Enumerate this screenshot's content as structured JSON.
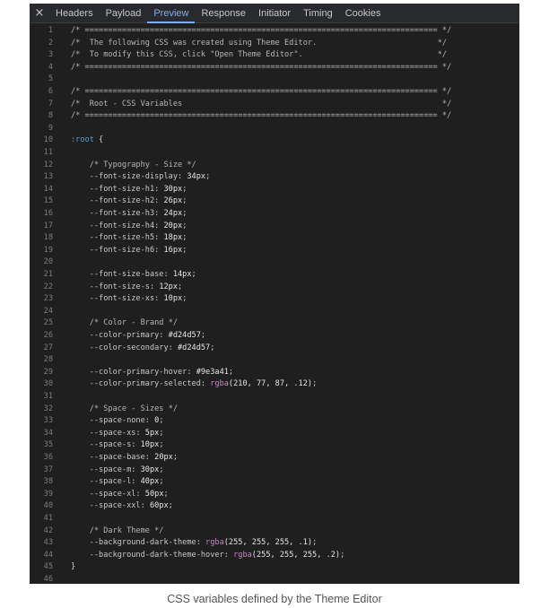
{
  "tabs": [
    {
      "label": "Headers",
      "active": false
    },
    {
      "label": "Payload",
      "active": false
    },
    {
      "label": "Preview",
      "active": true
    },
    {
      "label": "Response",
      "active": false
    },
    {
      "label": "Initiator",
      "active": false
    },
    {
      "label": "Timing",
      "active": false
    },
    {
      "label": "Cookies",
      "active": false
    }
  ],
  "close_icon": "×",
  "lines": [
    {
      "n": "1",
      "parts": [
        [
          "comment",
          "/* ============================================================================ */"
        ]
      ]
    },
    {
      "n": "2",
      "parts": [
        [
          "comment",
          "/*  The following CSS was created using Theme Editor.                          */"
        ]
      ]
    },
    {
      "n": "3",
      "parts": [
        [
          "comment",
          "/*  To modify this CSS, click \"Open Theme Editor\".                             */"
        ]
      ]
    },
    {
      "n": "4",
      "parts": [
        [
          "comment",
          "/* ============================================================================ */"
        ]
      ]
    },
    {
      "n": "5",
      "parts": []
    },
    {
      "n": "6",
      "parts": [
        [
          "comment",
          "/* ============================================================================ */"
        ]
      ]
    },
    {
      "n": "7",
      "parts": [
        [
          "comment",
          "/*  Root - CSS Variables                                                        */"
        ]
      ]
    },
    {
      "n": "8",
      "parts": [
        [
          "comment",
          "/* ============================================================================ */"
        ]
      ]
    },
    {
      "n": "9",
      "parts": []
    },
    {
      "n": "10",
      "parts": [
        [
          "selector",
          ":root"
        ],
        [
          "brace",
          " {"
        ]
      ]
    },
    {
      "n": "11",
      "parts": []
    },
    {
      "n": "12",
      "parts": [
        [
          "comment",
          "    /* Typography - Size */"
        ]
      ]
    },
    {
      "n": "13",
      "parts": [
        [
          "prop",
          "    --font-size-display: "
        ],
        [
          "num",
          "34px"
        ],
        [
          "prop",
          ";"
        ]
      ]
    },
    {
      "n": "14",
      "parts": [
        [
          "prop",
          "    --font-size-h1: "
        ],
        [
          "num",
          "30px"
        ],
        [
          "prop",
          ";"
        ]
      ]
    },
    {
      "n": "15",
      "parts": [
        [
          "prop",
          "    --font-size-h2: "
        ],
        [
          "num",
          "26px"
        ],
        [
          "prop",
          ";"
        ]
      ]
    },
    {
      "n": "16",
      "parts": [
        [
          "prop",
          "    --font-size-h3: "
        ],
        [
          "num",
          "24px"
        ],
        [
          "prop",
          ";"
        ]
      ]
    },
    {
      "n": "17",
      "parts": [
        [
          "prop",
          "    --font-size-h4: "
        ],
        [
          "num",
          "20px"
        ],
        [
          "prop",
          ";"
        ]
      ]
    },
    {
      "n": "18",
      "parts": [
        [
          "prop",
          "    --font-size-h5: "
        ],
        [
          "num",
          "18px"
        ],
        [
          "prop",
          ";"
        ]
      ]
    },
    {
      "n": "19",
      "parts": [
        [
          "prop",
          "    --font-size-h6: "
        ],
        [
          "num",
          "16px"
        ],
        [
          "prop",
          ";"
        ]
      ]
    },
    {
      "n": "20",
      "parts": []
    },
    {
      "n": "21",
      "parts": [
        [
          "prop",
          "    --font-size-base: "
        ],
        [
          "num",
          "14px"
        ],
        [
          "prop",
          ";"
        ]
      ]
    },
    {
      "n": "22",
      "parts": [
        [
          "prop",
          "    --font-size-s: "
        ],
        [
          "num",
          "12px"
        ],
        [
          "prop",
          ";"
        ]
      ]
    },
    {
      "n": "23",
      "parts": [
        [
          "prop",
          "    --font-size-xs: "
        ],
        [
          "num",
          "10px"
        ],
        [
          "prop",
          ";"
        ]
      ]
    },
    {
      "n": "24",
      "parts": []
    },
    {
      "n": "25",
      "parts": [
        [
          "comment",
          "    /* Color - Brand */"
        ]
      ]
    },
    {
      "n": "26",
      "parts": [
        [
          "prop",
          "    --color-primary: "
        ],
        [
          "num",
          "#d24d57"
        ],
        [
          "prop",
          ";"
        ]
      ]
    },
    {
      "n": "27",
      "parts": [
        [
          "prop",
          "    --color-secondary: "
        ],
        [
          "num",
          "#d24d57"
        ],
        [
          "prop",
          ";"
        ]
      ]
    },
    {
      "n": "28",
      "parts": []
    },
    {
      "n": "29",
      "parts": [
        [
          "prop",
          "    --color-primary-hover: "
        ],
        [
          "num",
          "#9e3a41"
        ],
        [
          "prop",
          ";"
        ]
      ]
    },
    {
      "n": "30",
      "parts": [
        [
          "prop",
          "    --color-primary-selected: "
        ],
        [
          "fn",
          "rgba"
        ],
        [
          "num",
          "(210, 77, 87, .12)"
        ],
        [
          "prop",
          ";"
        ]
      ]
    },
    {
      "n": "31",
      "parts": []
    },
    {
      "n": "32",
      "parts": [
        [
          "comment",
          "    /* Space - Sizes */"
        ]
      ]
    },
    {
      "n": "33",
      "parts": [
        [
          "prop",
          "    --space-none: "
        ],
        [
          "num",
          "0"
        ],
        [
          "prop",
          ";"
        ]
      ]
    },
    {
      "n": "34",
      "parts": [
        [
          "prop",
          "    --space-xs: "
        ],
        [
          "num",
          "5px"
        ],
        [
          "prop",
          ";"
        ]
      ]
    },
    {
      "n": "35",
      "parts": [
        [
          "prop",
          "    --space-s: "
        ],
        [
          "num",
          "10px"
        ],
        [
          "prop",
          ";"
        ]
      ]
    },
    {
      "n": "36",
      "parts": [
        [
          "prop",
          "    --space-base: "
        ],
        [
          "num",
          "20px"
        ],
        [
          "prop",
          ";"
        ]
      ]
    },
    {
      "n": "37",
      "parts": [
        [
          "prop",
          "    --space-m: "
        ],
        [
          "num",
          "30px"
        ],
        [
          "prop",
          ";"
        ]
      ]
    },
    {
      "n": "38",
      "parts": [
        [
          "prop",
          "    --space-l: "
        ],
        [
          "num",
          "40px"
        ],
        [
          "prop",
          ";"
        ]
      ]
    },
    {
      "n": "39",
      "parts": [
        [
          "prop",
          "    --space-xl: "
        ],
        [
          "num",
          "50px"
        ],
        [
          "prop",
          ";"
        ]
      ]
    },
    {
      "n": "40",
      "parts": [
        [
          "prop",
          "    --space-xxl: "
        ],
        [
          "num",
          "60px"
        ],
        [
          "prop",
          ";"
        ]
      ]
    },
    {
      "n": "41",
      "parts": []
    },
    {
      "n": "42",
      "parts": [
        [
          "comment",
          "    /* Dark Theme */"
        ]
      ]
    },
    {
      "n": "43",
      "parts": [
        [
          "prop",
          "    --background-dark-theme: "
        ],
        [
          "fn",
          "rgba"
        ],
        [
          "num",
          "(255, 255, 255, .1)"
        ],
        [
          "prop",
          ";"
        ]
      ]
    },
    {
      "n": "44",
      "parts": [
        [
          "prop",
          "    --background-dark-theme-hover: "
        ],
        [
          "fn",
          "rgba"
        ],
        [
          "num",
          "(255, 255, 255, .2)"
        ],
        [
          "prop",
          ";"
        ]
      ]
    },
    {
      "n": "45",
      "parts": [
        [
          "brace",
          "}"
        ]
      ]
    },
    {
      "n": "46",
      "parts": []
    }
  ],
  "caption": "CSS variables defined by the Theme Editor"
}
